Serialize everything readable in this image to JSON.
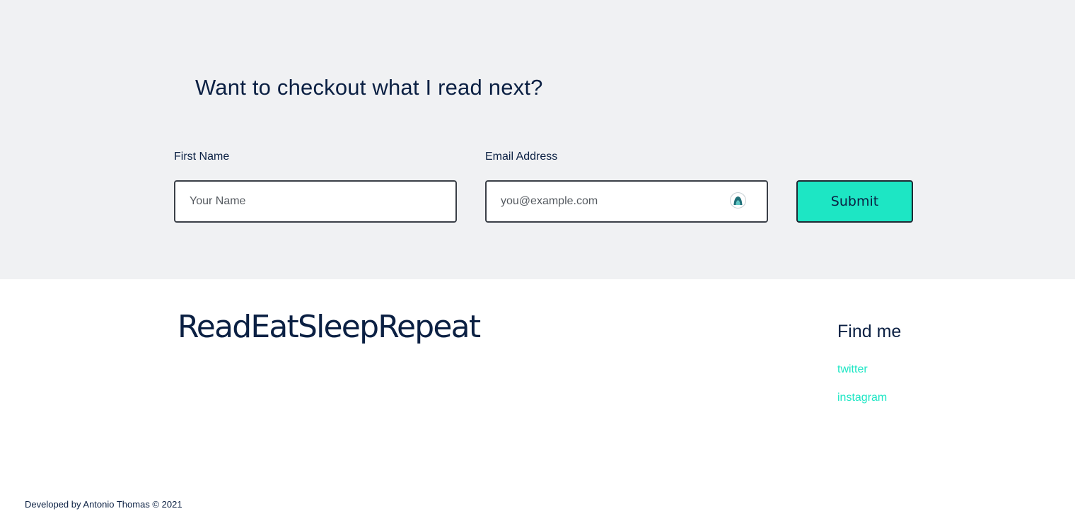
{
  "newsletter": {
    "title": "Want to checkout what I read next?",
    "name_label": "First Name",
    "name_placeholder": "Your Name",
    "email_label": "Email Address",
    "email_placeholder": "you@example.com",
    "submit_label": "Submit"
  },
  "footer": {
    "brand": "ReadEatSleepRepeat",
    "find_heading": "Find me",
    "links": [
      {
        "label": "twitter"
      },
      {
        "label": "instagram"
      }
    ],
    "credit": "Developed by Antonio Thomas © 2021"
  },
  "colors": {
    "accent": "#1de6c4",
    "navy": "#0b2043",
    "section_bg": "#f0f1f3"
  },
  "icons": {
    "autofill": "password-manager-icon"
  }
}
